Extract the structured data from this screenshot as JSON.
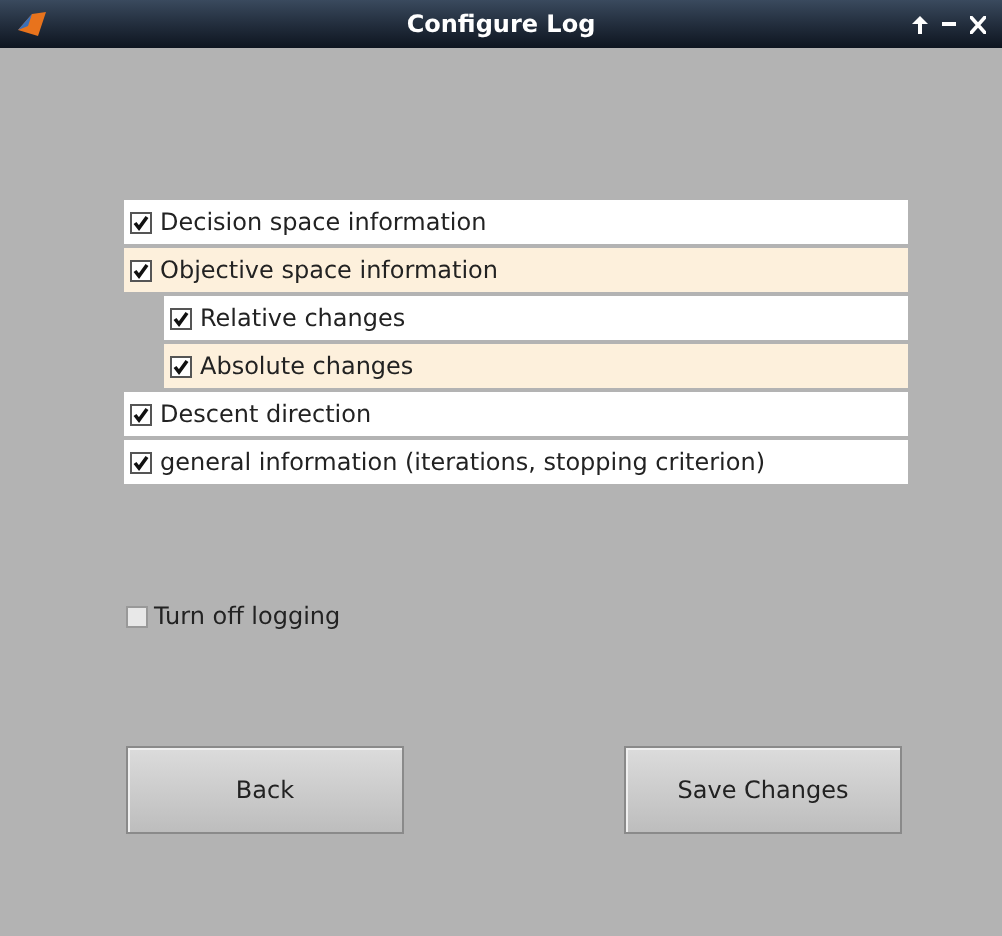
{
  "window": {
    "title": "Configure Log"
  },
  "options": [
    {
      "label": "Decision space information",
      "checked": true,
      "color": "#ffffff"
    },
    {
      "label": "Objective space information",
      "checked": true,
      "color": "#fdf0dc",
      "children": [
        {
          "label": "Relative changes",
          "checked": true,
          "color": "#ffffff"
        },
        {
          "label": "Absolute changes",
          "checked": true,
          "color": "#fdf0dc"
        }
      ]
    },
    {
      "label": "Descent direction",
      "checked": true,
      "color": "#ffffff"
    },
    {
      "label": "general information (iterations, stopping criterion)",
      "checked": true,
      "color": "#ffffff"
    }
  ],
  "turn_off_logging": {
    "label": "Turn off logging",
    "checked": false
  },
  "buttons": [
    "Back",
    "Save Changes"
  ]
}
